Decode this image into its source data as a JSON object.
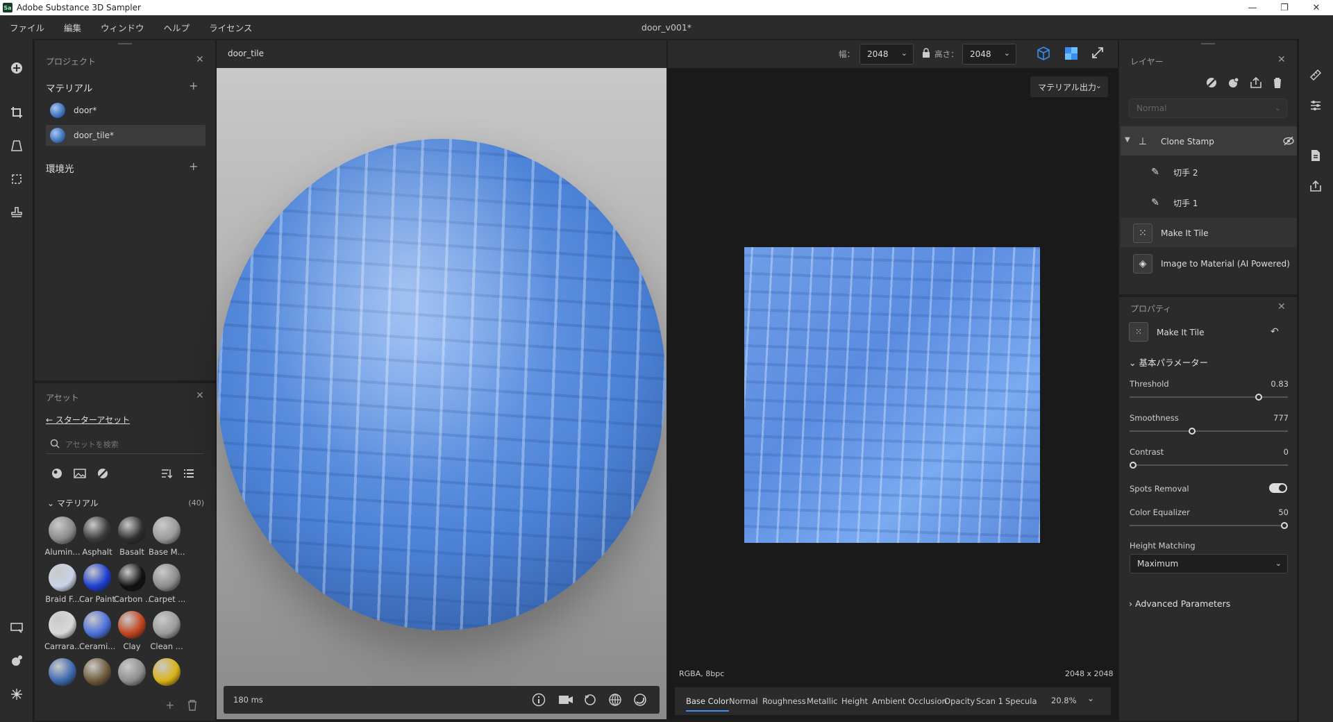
{
  "app": {
    "title": "Adobe Substance 3D Sampler",
    "logo_text": "Sa",
    "document_title": "door_v001*"
  },
  "menu": [
    "ファイル",
    "編集",
    "ウィンドウ",
    "ヘルプ",
    "ライセンス"
  ],
  "project": {
    "panel_title": "プロジェクト",
    "materials_heading": "マテリアル",
    "materials": [
      {
        "name": "door*",
        "selected": false
      },
      {
        "name": "door_tile*",
        "selected": true
      }
    ],
    "environment_heading": "環境光"
  },
  "assets": {
    "panel_title": "アセット",
    "breadcrumb": "スターターアセット",
    "search_placeholder": "アセットを検索",
    "category": "マテリアル",
    "count": "(40)",
    "swatches": [
      {
        "label": "Alumin...",
        "color": "#8a8a8a"
      },
      {
        "label": "Asphalt",
        "color": "#3a3a3a"
      },
      {
        "label": "Basalt",
        "color": "#2f2f2f"
      },
      {
        "label": "Base M...",
        "color": "#9a9a9a"
      },
      {
        "label": "Braid F...",
        "color": "#c9d2e6"
      },
      {
        "label": "Car Paint",
        "color": "#1d3fd0"
      },
      {
        "label": "Carbon ...",
        "color": "#111111"
      },
      {
        "label": "Carpet ...",
        "color": "#8c8c8c"
      },
      {
        "label": "Carrara...",
        "color": "#d8d8d8"
      },
      {
        "label": "Cerami...",
        "color": "#4a6fd8"
      },
      {
        "label": "Clay",
        "color": "#c0441c"
      },
      {
        "label": "Clean ...",
        "color": "#9a9a9a"
      },
      {
        "label": "",
        "color": "#3d69b0"
      },
      {
        "label": "",
        "color": "#6e5a3a"
      },
      {
        "label": "",
        "color": "#8e8e8e"
      },
      {
        "label": "",
        "color": "#d9b218"
      }
    ]
  },
  "viewport3d": {
    "tab": "door_tile",
    "render_time": "180 ms"
  },
  "toolbar": {
    "width_label": "幅：",
    "width_value": "2048",
    "height_label": "高さ：",
    "height_value": "2048",
    "export_label": "マテリアル出力"
  },
  "viewport2d": {
    "format": "RGBA, 8bpc",
    "resolution": "2048 x 2048",
    "zoom": "20.8%",
    "channels": [
      "Base Color",
      "Normal",
      "Roughness",
      "Metallic",
      "Height",
      "Ambient Occlusion",
      "Opacity",
      "Scan 1",
      "Specula"
    ],
    "active_channel": "Base Color"
  },
  "layers": {
    "panel_title": "レイヤー",
    "blend_mode": "Normal",
    "items": [
      {
        "name": "Clone Stamp",
        "icon": "stamp-icon"
      },
      {
        "name": "切手 2",
        "icon": "brush-icon"
      },
      {
        "name": "切手 1",
        "icon": "brush-icon"
      },
      {
        "name": "Make It Tile",
        "icon": "tile-icon"
      },
      {
        "name": "Image to Material (AI Powered)",
        "icon": "image-icon"
      }
    ]
  },
  "properties": {
    "panel_title": "プロパティ",
    "filter_name": "Make It Tile",
    "basic_heading": "基本パラメーター",
    "threshold": {
      "label": "Threshold",
      "value": "0.83",
      "fraction": 0.83
    },
    "smoothness": {
      "label": "Smoothness",
      "value": "777",
      "fraction": 0.39
    },
    "contrast": {
      "label": "Contrast",
      "value": "0",
      "fraction": 0.0
    },
    "spots_removal": {
      "label": "Spots Removal",
      "on": true
    },
    "color_equalizer": {
      "label": "Color Equalizer",
      "value": "50",
      "fraction": 1.0
    },
    "height_matching": {
      "label": "Height Matching",
      "value": "Maximum"
    },
    "advanced_heading": "Advanced Parameters"
  }
}
